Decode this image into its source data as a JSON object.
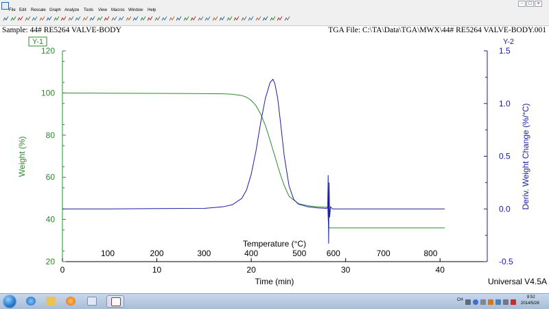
{
  "menu": {
    "items": [
      "File",
      "Edit",
      "Rescale",
      "Graph",
      "Analyze",
      "Tools",
      "View",
      "Macros",
      "Window",
      "Help"
    ]
  },
  "window_buttons": [
    "-",
    "□",
    "×"
  ],
  "header": {
    "sample": "Sample: 44# RE5264 VALVE-BODY",
    "file": "TGA File: C:\\TA\\Data\\TGA\\MWX\\44# RE5264 VALVE-BODY.001"
  },
  "footer": {
    "version": "Universal V4.5A"
  },
  "taskbar": {
    "lang": "CH",
    "time": "8:52",
    "date": "2014/5/28"
  },
  "colors": {
    "weight": "#2b8a2b",
    "deriv": "#1a1aa8",
    "axis_left": "#2b8a2b",
    "axis_right": "#1a1aa8"
  },
  "chart_data": {
    "type": "line",
    "y1_tag": "Y-1",
    "y2_tag": "Y-2",
    "xlabel": "Time (min)",
    "x2label": "Temperature (°C)",
    "ylabel": "Weight (%)",
    "y2label": "Deriv. Weight Change (%/°C)",
    "xlim": [
      0,
      45
    ],
    "xticks": [
      0,
      10,
      20,
      30,
      40
    ],
    "ylim": [
      20,
      120
    ],
    "yticks": [
      20,
      40,
      60,
      80,
      100,
      120
    ],
    "y2lim": [
      -0.5,
      1.5
    ],
    "y2ticks": [
      -0.5,
      0.0,
      0.5,
      1.0,
      1.5
    ],
    "y2ticklabels": [
      "-0.5",
      "0.0",
      "0.5",
      "1.0",
      "1.5"
    ],
    "temp_ticks": [
      {
        "label": "100",
        "time": 4.8
      },
      {
        "label": "200",
        "time": 10.0
      },
      {
        "label": "300",
        "time": 15.0
      },
      {
        "label": "400",
        "time": 20.0
      },
      {
        "label": "500",
        "time": 25.1
      },
      {
        "label": "600",
        "time": 28.7
      },
      {
        "label": "700",
        "time": 34.0
      },
      {
        "label": "800",
        "time": 39.0
      }
    ],
    "series": [
      {
        "name": "Weight (%)",
        "axis": "y1",
        "x": [
          0,
          5,
          10,
          15,
          17,
          18,
          19,
          19.5,
          20,
          20.5,
          21,
          21.5,
          22,
          22.5,
          23,
          23.5,
          24,
          25,
          26,
          27,
          28,
          28.1,
          28.15,
          28.2,
          28.3,
          30,
          35,
          40.5
        ],
        "y": [
          100.0,
          99.9,
          99.8,
          99.7,
          99.6,
          99.4,
          98.8,
          98.0,
          96.5,
          94.0,
          90.0,
          84.5,
          77.5,
          70.0,
          62.5,
          56.0,
          51.0,
          47.5,
          46.5,
          46.0,
          45.8,
          45.6,
          40.0,
          36.5,
          36.0,
          36.0,
          36.0,
          36.0
        ]
      },
      {
        "name": "Deriv. Weight Change (%/°C)",
        "axis": "y2",
        "x": [
          0,
          5,
          10,
          15,
          17,
          18,
          19,
          19.5,
          20,
          20.5,
          21,
          21.5,
          22,
          22.3,
          22.5,
          22.8,
          23,
          23.5,
          24,
          24.5,
          25,
          26,
          27,
          28,
          28.1,
          28.15,
          28.2,
          28.25,
          28.3,
          28.4,
          28.6,
          29,
          35,
          40.5
        ],
        "y": [
          0.0,
          0.0,
          0.003,
          0.005,
          0.02,
          0.04,
          0.1,
          0.18,
          0.33,
          0.55,
          0.82,
          1.05,
          1.2,
          1.23,
          1.19,
          1.05,
          0.9,
          0.5,
          0.22,
          0.09,
          0.045,
          0.02,
          0.01,
          0.005,
          0.02,
          0.32,
          -0.33,
          0.25,
          -0.08,
          0.02,
          0.0,
          0.0,
          0.0,
          0.0
        ]
      }
    ],
    "grid": false,
    "legend": "none"
  }
}
